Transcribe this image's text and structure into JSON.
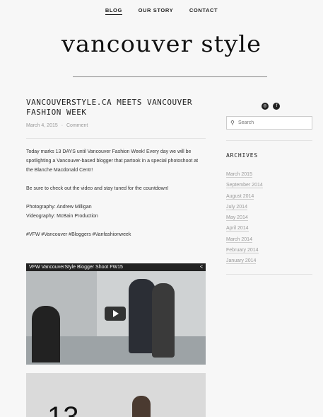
{
  "nav": {
    "items": [
      "BLOG",
      "OUR STORY",
      "CONTACT"
    ],
    "active": "BLOG"
  },
  "site": {
    "logo_text": "vancouver style"
  },
  "post": {
    "title": "VANCOUVERSTYLE.CA MEETS VANCOUVER FASHION WEEK",
    "date": "March 4, 2015",
    "separator": "·",
    "comment_link": "Comment",
    "paragraphs": [
      "Today marks 13 DAYS until Vancouver Fashion Week! Every day we will be spotlighting a Vancouver-based blogger that partook in a special photoshoot at the Blanche Macdonald Centr!",
      "Be sure to check out the video and stay tuned for the countdown!",
      "Photography: Andrew Milligan",
      "Videography: McBain Production",
      "#VFW #Vancouver #Bloggers #Vanfashionweek"
    ],
    "video_title": "VFW VancouverStyle Blogger Shoot FW15",
    "photo_number": "13"
  },
  "sidebar": {
    "social": [
      {
        "icon": "instagram-icon",
        "glyph": "◎"
      },
      {
        "icon": "facebook-icon",
        "glyph": "f"
      }
    ],
    "search_placeholder": "Search",
    "archives_title": "ARCHIVES",
    "archives": [
      "March 2015",
      "September 2014",
      "August 2014",
      "July 2014",
      "May 2014",
      "April 2014",
      "March 2014",
      "February 2014",
      "January 2014"
    ]
  }
}
